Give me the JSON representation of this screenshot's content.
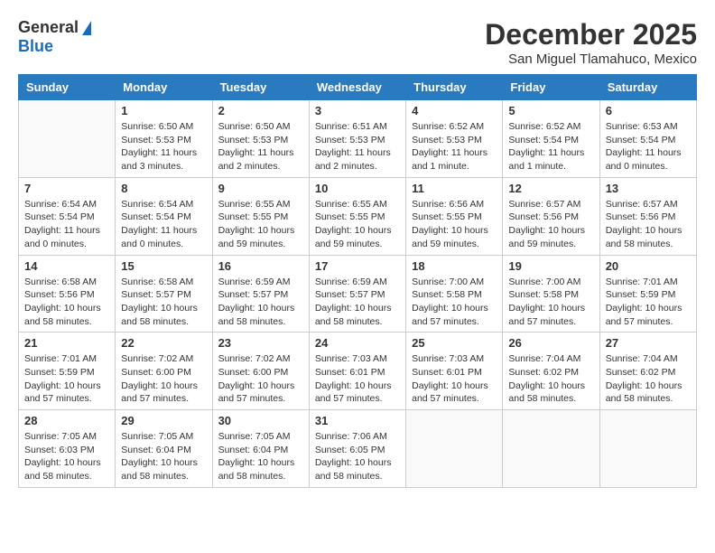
{
  "header": {
    "logo_general": "General",
    "logo_blue": "Blue",
    "month_title": "December 2025",
    "location": "San Miguel Tlamahuco, Mexico"
  },
  "weekdays": [
    "Sunday",
    "Monday",
    "Tuesday",
    "Wednesday",
    "Thursday",
    "Friday",
    "Saturday"
  ],
  "weeks": [
    [
      {
        "day": "",
        "info": ""
      },
      {
        "day": "1",
        "info": "Sunrise: 6:50 AM\nSunset: 5:53 PM\nDaylight: 11 hours\nand 3 minutes."
      },
      {
        "day": "2",
        "info": "Sunrise: 6:50 AM\nSunset: 5:53 PM\nDaylight: 11 hours\nand 2 minutes."
      },
      {
        "day": "3",
        "info": "Sunrise: 6:51 AM\nSunset: 5:53 PM\nDaylight: 11 hours\nand 2 minutes."
      },
      {
        "day": "4",
        "info": "Sunrise: 6:52 AM\nSunset: 5:53 PM\nDaylight: 11 hours\nand 1 minute."
      },
      {
        "day": "5",
        "info": "Sunrise: 6:52 AM\nSunset: 5:54 PM\nDaylight: 11 hours\nand 1 minute."
      },
      {
        "day": "6",
        "info": "Sunrise: 6:53 AM\nSunset: 5:54 PM\nDaylight: 11 hours\nand 0 minutes."
      }
    ],
    [
      {
        "day": "7",
        "info": "Sunrise: 6:54 AM\nSunset: 5:54 PM\nDaylight: 11 hours\nand 0 minutes."
      },
      {
        "day": "8",
        "info": "Sunrise: 6:54 AM\nSunset: 5:54 PM\nDaylight: 11 hours\nand 0 minutes."
      },
      {
        "day": "9",
        "info": "Sunrise: 6:55 AM\nSunset: 5:55 PM\nDaylight: 10 hours\nand 59 minutes."
      },
      {
        "day": "10",
        "info": "Sunrise: 6:55 AM\nSunset: 5:55 PM\nDaylight: 10 hours\nand 59 minutes."
      },
      {
        "day": "11",
        "info": "Sunrise: 6:56 AM\nSunset: 5:55 PM\nDaylight: 10 hours\nand 59 minutes."
      },
      {
        "day": "12",
        "info": "Sunrise: 6:57 AM\nSunset: 5:56 PM\nDaylight: 10 hours\nand 59 minutes."
      },
      {
        "day": "13",
        "info": "Sunrise: 6:57 AM\nSunset: 5:56 PM\nDaylight: 10 hours\nand 58 minutes."
      }
    ],
    [
      {
        "day": "14",
        "info": "Sunrise: 6:58 AM\nSunset: 5:56 PM\nDaylight: 10 hours\nand 58 minutes."
      },
      {
        "day": "15",
        "info": "Sunrise: 6:58 AM\nSunset: 5:57 PM\nDaylight: 10 hours\nand 58 minutes."
      },
      {
        "day": "16",
        "info": "Sunrise: 6:59 AM\nSunset: 5:57 PM\nDaylight: 10 hours\nand 58 minutes."
      },
      {
        "day": "17",
        "info": "Sunrise: 6:59 AM\nSunset: 5:57 PM\nDaylight: 10 hours\nand 58 minutes."
      },
      {
        "day": "18",
        "info": "Sunrise: 7:00 AM\nSunset: 5:58 PM\nDaylight: 10 hours\nand 57 minutes."
      },
      {
        "day": "19",
        "info": "Sunrise: 7:00 AM\nSunset: 5:58 PM\nDaylight: 10 hours\nand 57 minutes."
      },
      {
        "day": "20",
        "info": "Sunrise: 7:01 AM\nSunset: 5:59 PM\nDaylight: 10 hours\nand 57 minutes."
      }
    ],
    [
      {
        "day": "21",
        "info": "Sunrise: 7:01 AM\nSunset: 5:59 PM\nDaylight: 10 hours\nand 57 minutes."
      },
      {
        "day": "22",
        "info": "Sunrise: 7:02 AM\nSunset: 6:00 PM\nDaylight: 10 hours\nand 57 minutes."
      },
      {
        "day": "23",
        "info": "Sunrise: 7:02 AM\nSunset: 6:00 PM\nDaylight: 10 hours\nand 57 minutes."
      },
      {
        "day": "24",
        "info": "Sunrise: 7:03 AM\nSunset: 6:01 PM\nDaylight: 10 hours\nand 57 minutes."
      },
      {
        "day": "25",
        "info": "Sunrise: 7:03 AM\nSunset: 6:01 PM\nDaylight: 10 hours\nand 57 minutes."
      },
      {
        "day": "26",
        "info": "Sunrise: 7:04 AM\nSunset: 6:02 PM\nDaylight: 10 hours\nand 58 minutes."
      },
      {
        "day": "27",
        "info": "Sunrise: 7:04 AM\nSunset: 6:02 PM\nDaylight: 10 hours\nand 58 minutes."
      }
    ],
    [
      {
        "day": "28",
        "info": "Sunrise: 7:05 AM\nSunset: 6:03 PM\nDaylight: 10 hours\nand 58 minutes."
      },
      {
        "day": "29",
        "info": "Sunrise: 7:05 AM\nSunset: 6:04 PM\nDaylight: 10 hours\nand 58 minutes."
      },
      {
        "day": "30",
        "info": "Sunrise: 7:05 AM\nSunset: 6:04 PM\nDaylight: 10 hours\nand 58 minutes."
      },
      {
        "day": "31",
        "info": "Sunrise: 7:06 AM\nSunset: 6:05 PM\nDaylight: 10 hours\nand 58 minutes."
      },
      {
        "day": "",
        "info": ""
      },
      {
        "day": "",
        "info": ""
      },
      {
        "day": "",
        "info": ""
      }
    ]
  ]
}
